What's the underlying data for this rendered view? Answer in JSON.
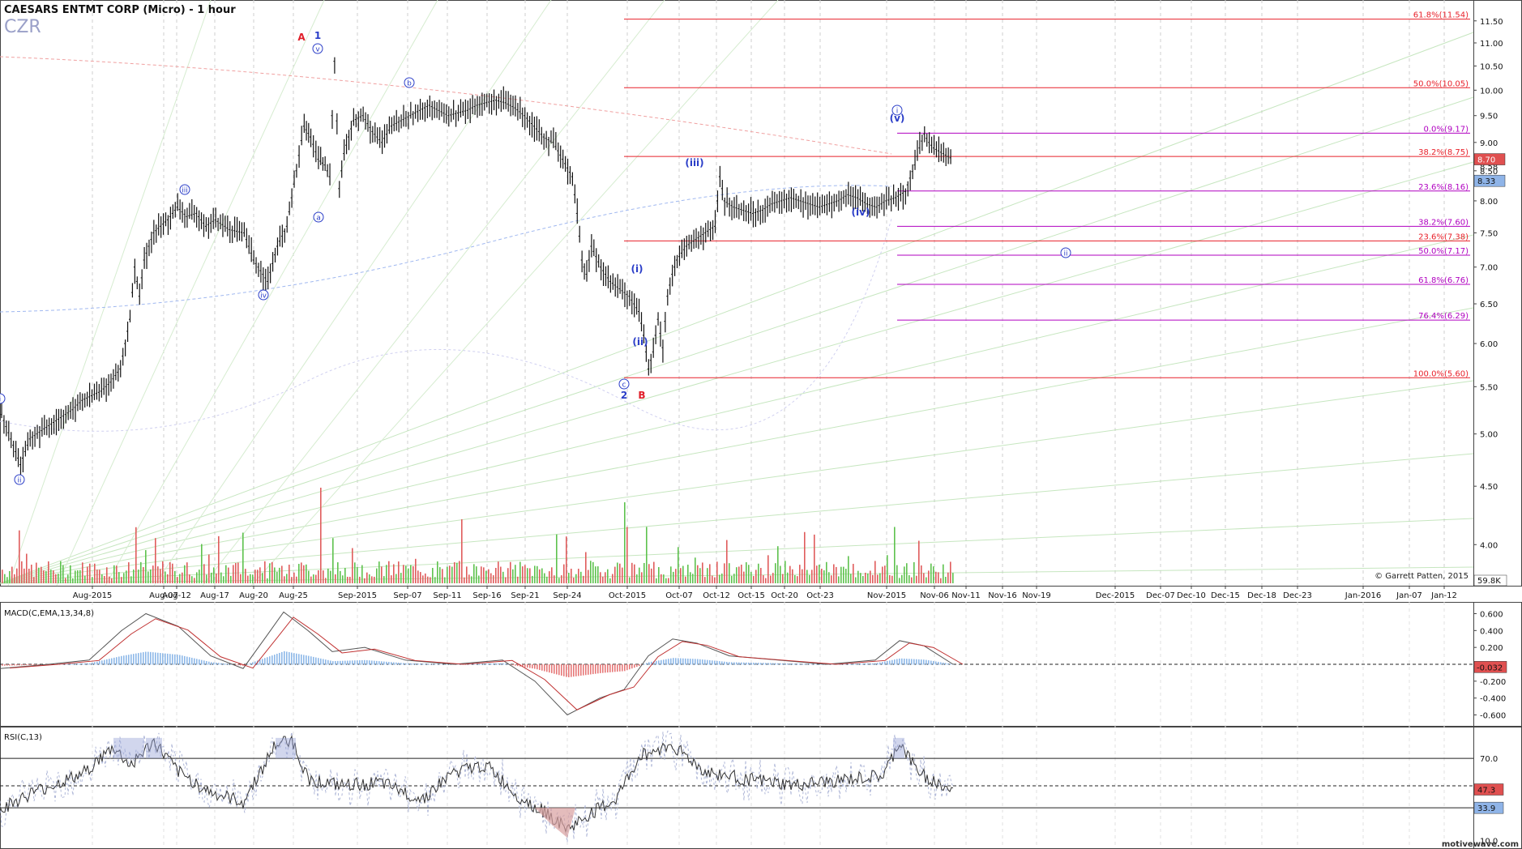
{
  "header": {
    "title": "CAESARS ENTMT CORP (Micro) - 1 hour",
    "symbol": "CZR"
  },
  "copyright": "© Garrett Patten, 2015",
  "watermark": "motivewave.com",
  "colors": {
    "fib_red": "#e8202a",
    "fib_magenta": "#b000c0",
    "wave_blue": "#2b3ec8",
    "wave_red": "#e0202a",
    "macd_pos": "#8db8e8",
    "macd_neg": "#e67878",
    "last_price_bg": "#e05050",
    "current_bg": "#8fb4e8",
    "volume_green": "#5ec24e",
    "volume_red": "#e05c5c"
  },
  "x_axis": {
    "labels": [
      "Aug-2015",
      "Aug-07",
      "Aug-12",
      "Aug-17",
      "Aug-20",
      "Aug-25",
      "Sep-2015",
      "Sep-07",
      "Sep-11",
      "Sep-16",
      "Sep-21",
      "Sep-24",
      "Oct-2015",
      "Oct-07",
      "Oct-12",
      "Oct-15",
      "Oct-20",
      "Oct-23",
      "Nov-2015",
      "Nov-06",
      "Nov-11",
      "Nov-16",
      "Nov-19",
      "Dec-2015",
      "Dec-07",
      "Dec-10",
      "Dec-15",
      "Dec-18",
      "Dec-23",
      "Jan-2016",
      "Jan-07",
      "Jan-12"
    ]
  },
  "price_axis": {
    "ticks": [
      "11.50",
      "11.00",
      "10.50",
      "10.00",
      "9.50",
      "9.00",
      "8.50",
      "8.00",
      "7.50",
      "7.00",
      "6.50",
      "6.00",
      "5.50",
      "5.00",
      "4.50",
      "4.00"
    ],
    "last_price": "8.70",
    "current_price": "8.33",
    "prev_label": "8.58",
    "volume_label": "59.8K"
  },
  "fib_levels": [
    {
      "label": "61.8%(11.54)",
      "color": "red"
    },
    {
      "label": "50.0%(10.05)",
      "color": "red"
    },
    {
      "label": "0.0%(9.17)",
      "color": "magenta"
    },
    {
      "label": "38.2%(8.75)",
      "color": "red"
    },
    {
      "label": "23.6%(8.16)",
      "color": "magenta"
    },
    {
      "label": "38.2%(7.60)",
      "color": "magenta"
    },
    {
      "label": "23.6%(7.38)",
      "color": "red"
    },
    {
      "label": "50.0%(7.17)",
      "color": "magenta"
    },
    {
      "label": "61.8%(6.76)",
      "color": "magenta"
    },
    {
      "label": "76.4%(6.29)",
      "color": "magenta"
    },
    {
      "label": "100.0%(5.60)",
      "color": "red"
    }
  ],
  "wave_labels": [
    {
      "text": "A",
      "color": "red"
    },
    {
      "text": "1",
      "color": "blue"
    },
    {
      "text": "v",
      "color": "blue"
    },
    {
      "text": "b",
      "color": "blue"
    },
    {
      "text": "a",
      "color": "blue"
    },
    {
      "text": "iii",
      "color": "blue"
    },
    {
      "text": "iv",
      "color": "blue"
    },
    {
      "text": "ii",
      "color": "blue"
    },
    {
      "text": "i",
      "color": "blue"
    },
    {
      "text": "(iii)",
      "color": "blue"
    },
    {
      "text": "(iv)",
      "color": "blue"
    },
    {
      "text": "(i)",
      "color": "blue"
    },
    {
      "text": "(ii)",
      "color": "blue"
    },
    {
      "text": "(v)",
      "color": "blue"
    },
    {
      "text": "i",
      "color": "blue"
    },
    {
      "text": "ii",
      "color": "blue"
    },
    {
      "text": "c",
      "color": "blue"
    },
    {
      "text": "2",
      "color": "blue"
    },
    {
      "text": "B",
      "color": "red"
    }
  ],
  "macd": {
    "title": "MACD(C,EMA,13,34,8)",
    "ticks": [
      "0.600",
      "0.400",
      "0.200",
      "-0.200",
      "-0.400",
      "-0.600"
    ],
    "current": "-0.032"
  },
  "rsi": {
    "title": "RSI(C,13)",
    "ticks": [
      "70.0",
      "10.0"
    ],
    "current": "47.3",
    "lower_band": "33.9"
  },
  "chart_data": {
    "type": "line",
    "title": "CAESARS ENTMT CORP (Micro) - 1 hour",
    "ylim": [
      3.7,
      11.8
    ],
    "scale": "log",
    "series": [
      {
        "name": "CZR",
        "points": [
          [
            0.0,
            5.2
          ],
          [
            0.01,
            4.95
          ],
          [
            0.02,
            4.7
          ],
          [
            0.03,
            4.95
          ],
          [
            0.045,
            5.05
          ],
          [
            0.06,
            5.15
          ],
          [
            0.075,
            5.25
          ],
          [
            0.085,
            5.35
          ],
          [
            0.095,
            5.4
          ],
          [
            0.105,
            5.45
          ],
          [
            0.115,
            5.55
          ],
          [
            0.125,
            5.7
          ],
          [
            0.135,
            6.3
          ],
          [
            0.14,
            7.0
          ],
          [
            0.145,
            6.6
          ],
          [
            0.15,
            7.1
          ],
          [
            0.16,
            7.5
          ],
          [
            0.175,
            7.7
          ],
          [
            0.185,
            7.9
          ],
          [
            0.195,
            7.75
          ],
          [
            0.205,
            7.8
          ],
          [
            0.215,
            7.6
          ],
          [
            0.225,
            7.7
          ],
          [
            0.24,
            7.55
          ],
          [
            0.255,
            7.5
          ],
          [
            0.265,
            7.1
          ],
          [
            0.275,
            6.9
          ],
          [
            0.28,
            6.8
          ],
          [
            0.29,
            7.3
          ],
          [
            0.3,
            7.6
          ],
          [
            0.31,
            8.5
          ],
          [
            0.318,
            9.3
          ],
          [
            0.325,
            9.1
          ],
          [
            0.333,
            8.7
          ],
          [
            0.34,
            8.6
          ],
          [
            0.345,
            8.4
          ],
          [
            0.35,
            10.6
          ],
          [
            0.355,
            8.2
          ],
          [
            0.36,
            8.8
          ],
          [
            0.37,
            9.4
          ],
          [
            0.38,
            9.5
          ],
          [
            0.39,
            9.2
          ],
          [
            0.4,
            9.0
          ],
          [
            0.41,
            9.3
          ],
          [
            0.42,
            9.4
          ],
          [
            0.43,
            9.5
          ],
          [
            0.44,
            9.6
          ],
          [
            0.45,
            9.7
          ],
          [
            0.46,
            9.6
          ],
          [
            0.47,
            9.5
          ],
          [
            0.48,
            9.55
          ],
          [
            0.49,
            9.6
          ],
          [
            0.5,
            9.7
          ],
          [
            0.51,
            9.75
          ],
          [
            0.52,
            9.8
          ],
          [
            0.53,
            9.75
          ],
          [
            0.54,
            9.65
          ],
          [
            0.55,
            9.5
          ],
          [
            0.56,
            9.3
          ],
          [
            0.57,
            9.1
          ],
          [
            0.58,
            9.0
          ],
          [
            0.59,
            8.7
          ],
          [
            0.6,
            8.4
          ],
          [
            0.605,
            7.8
          ],
          [
            0.61,
            7.1
          ],
          [
            0.615,
            6.9
          ],
          [
            0.62,
            7.3
          ],
          [
            0.63,
            7.0
          ],
          [
            0.64,
            6.8
          ],
          [
            0.65,
            6.7
          ],
          [
            0.66,
            6.6
          ],
          [
            0.67,
            6.4
          ],
          [
            0.675,
            6.1
          ],
          [
            0.68,
            5.7
          ],
          [
            0.685,
            5.9
          ],
          [
            0.69,
            6.3
          ],
          [
            0.695,
            5.95
          ],
          [
            0.7,
            6.6
          ],
          [
            0.705,
            6.9
          ],
          [
            0.71,
            7.1
          ],
          [
            0.72,
            7.3
          ],
          [
            0.73,
            7.4
          ],
          [
            0.74,
            7.5
          ],
          [
            0.75,
            7.6
          ],
          [
            0.755,
            8.4
          ],
          [
            0.76,
            8.0
          ],
          [
            0.77,
            7.9
          ],
          [
            0.78,
            7.85
          ],
          [
            0.79,
            7.8
          ],
          [
            0.8,
            7.85
          ],
          [
            0.81,
            7.95
          ],
          [
            0.82,
            8.0
          ],
          [
            0.83,
            8.05
          ],
          [
            0.84,
            8.0
          ],
          [
            0.85,
            7.95
          ],
          [
            0.86,
            7.9
          ],
          [
            0.87,
            7.95
          ],
          [
            0.88,
            8.0
          ],
          [
            0.89,
            8.1
          ],
          [
            0.9,
            8.05
          ],
          [
            0.91,
            7.95
          ],
          [
            0.92,
            7.9
          ],
          [
            0.93,
            8.0
          ],
          [
            0.94,
            8.05
          ],
          [
            0.95,
            8.15
          ],
          [
            0.96,
            8.6
          ],
          [
            0.965,
            8.9
          ],
          [
            0.97,
            9.15
          ],
          [
            0.975,
            9.0
          ],
          [
            0.98,
            8.9
          ],
          [
            0.985,
            8.85
          ],
          [
            0.99,
            8.8
          ],
          [
            0.995,
            8.75
          ],
          [
            1.0,
            8.7
          ]
        ]
      }
    ]
  }
}
